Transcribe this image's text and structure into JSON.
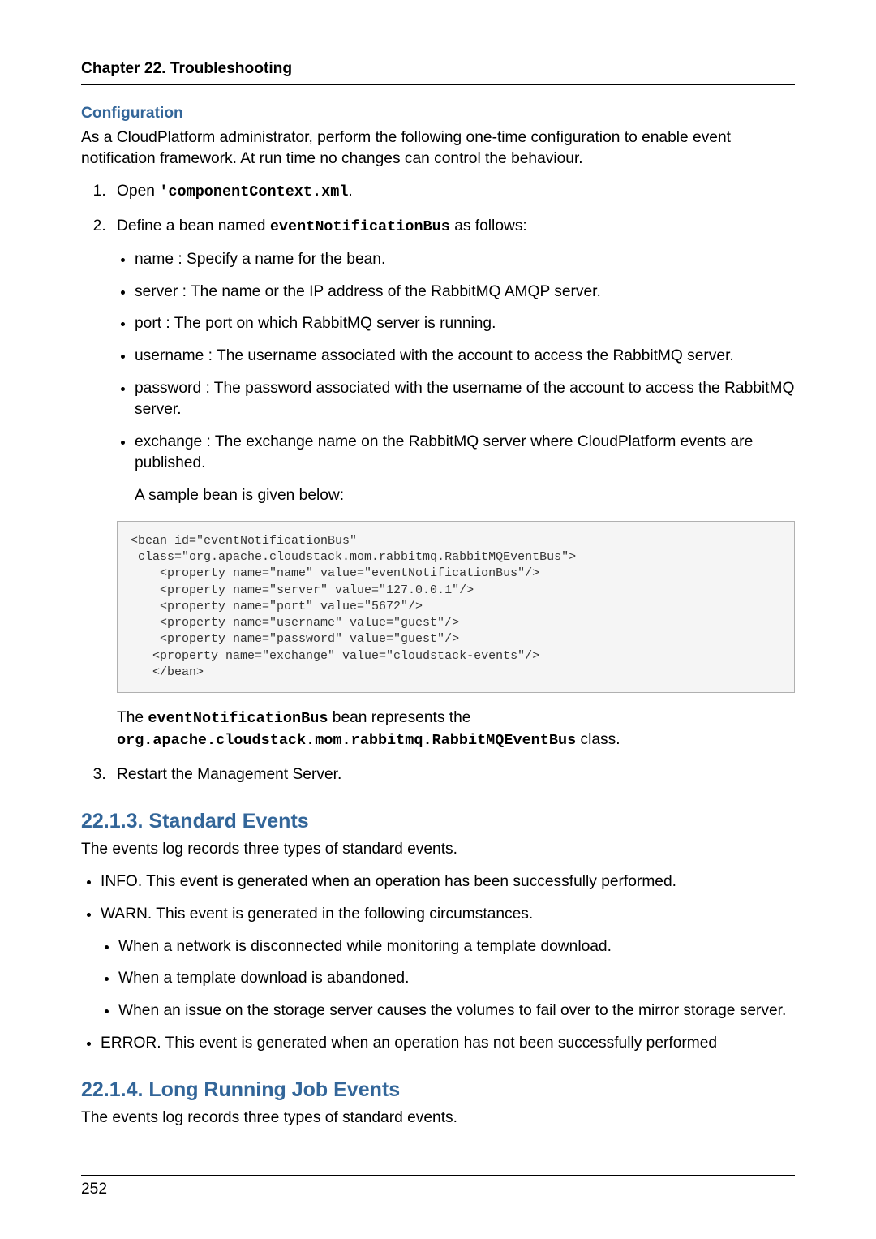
{
  "running_head": "Chapter 22. Troubleshooting",
  "config": {
    "title": "Configuration",
    "intro": "As a CloudPlatform administrator, perform the following one-time configuration to enable event notification framework. At run time no changes can control the behaviour.",
    "step1_prefix": "Open ",
    "step1_code": "'componentContext.xml",
    "step1_suffix": ".",
    "step2_prefix": "Define a bean named ",
    "step2_code": "eventNotificationBus",
    "step2_suffix": " as follows:",
    "params": {
      "name": "name : Specify a name for the bean.",
      "server": "server : The name or the IP address of the RabbitMQ AMQP server.",
      "port": "port : The port on which RabbitMQ server is running.",
      "username": "username : The username associated with the account to access the RabbitMQ server.",
      "password": "password : The password associated with the username of the account to access the RabbitMQ server.",
      "exchange": "exchange : The exchange name on the RabbitMQ server where CloudPlatform events are published.",
      "sample_intro": "A sample bean is given below:"
    },
    "code": "<bean id=\"eventNotificationBus\"\n class=\"org.apache.cloudstack.mom.rabbitmq.RabbitMQEventBus\">\n    <property name=\"name\" value=\"eventNotificationBus\"/>\n    <property name=\"server\" value=\"127.0.0.1\"/>\n    <property name=\"port\" value=\"5672\"/>\n    <property name=\"username\" value=\"guest\"/>\n    <property name=\"password\" value=\"guest\"/>\n   <property name=\"exchange\" value=\"cloudstack-events\"/>\n   </bean>",
    "after_code_prefix": "The ",
    "after_code_code1": "eventNotificationBus",
    "after_code_mid": " bean represents the",
    "after_code_code2": "org.apache.cloudstack.mom.rabbitmq.RabbitMQEventBus",
    "after_code_suffix": " class.",
    "step3": "Restart the Management Server."
  },
  "standard": {
    "title": "22.1.3. Standard Events",
    "intro": "The events log records three types of standard events.",
    "info": "INFO. This event is generated when an operation has been successfully performed.",
    "warn": "WARN. This event is generated in the following circumstances.",
    "warn1": "When a network is disconnected while monitoring a template download.",
    "warn2": "When a template download is abandoned.",
    "warn3": "When an issue on the storage server causes the volumes to fail over to the mirror storage server.",
    "error": "ERROR. This event is generated when an operation has not been successfully performed"
  },
  "long_running": {
    "title": "22.1.4. Long Running Job Events",
    "intro": "The events log records three types of standard events."
  },
  "page_number": "252"
}
